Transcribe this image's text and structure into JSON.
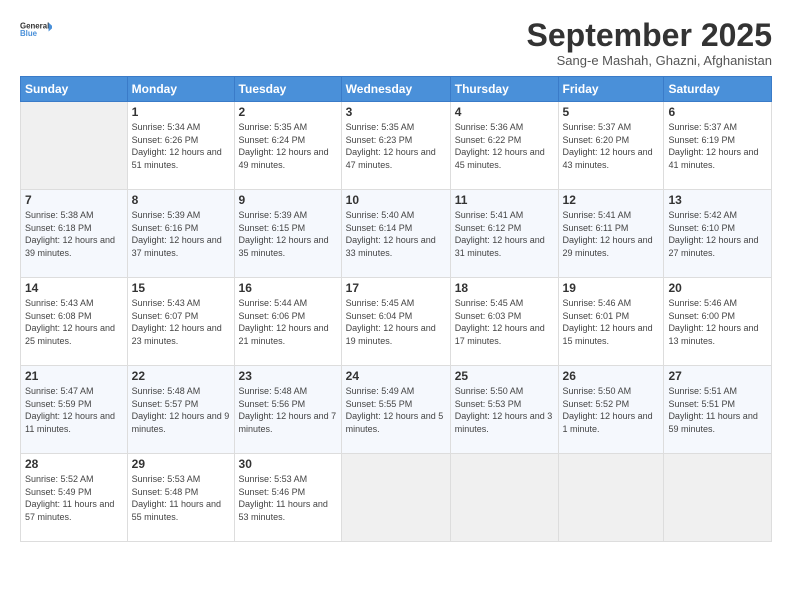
{
  "logo": {
    "general": "General",
    "blue": "Blue"
  },
  "header": {
    "title": "September 2025",
    "subtitle": "Sang-e Mashah, Ghazni, Afghanistan"
  },
  "days_of_week": [
    "Sunday",
    "Monday",
    "Tuesday",
    "Wednesday",
    "Thursday",
    "Friday",
    "Saturday"
  ],
  "weeks": [
    [
      {
        "day": "",
        "sunrise": "",
        "sunset": "",
        "daylight": "",
        "empty": true
      },
      {
        "day": "1",
        "sunrise": "Sunrise: 5:34 AM",
        "sunset": "Sunset: 6:26 PM",
        "daylight": "Daylight: 12 hours and 51 minutes."
      },
      {
        "day": "2",
        "sunrise": "Sunrise: 5:35 AM",
        "sunset": "Sunset: 6:24 PM",
        "daylight": "Daylight: 12 hours and 49 minutes."
      },
      {
        "day": "3",
        "sunrise": "Sunrise: 5:35 AM",
        "sunset": "Sunset: 6:23 PM",
        "daylight": "Daylight: 12 hours and 47 minutes."
      },
      {
        "day": "4",
        "sunrise": "Sunrise: 5:36 AM",
        "sunset": "Sunset: 6:22 PM",
        "daylight": "Daylight: 12 hours and 45 minutes."
      },
      {
        "day": "5",
        "sunrise": "Sunrise: 5:37 AM",
        "sunset": "Sunset: 6:20 PM",
        "daylight": "Daylight: 12 hours and 43 minutes."
      },
      {
        "day": "6",
        "sunrise": "Sunrise: 5:37 AM",
        "sunset": "Sunset: 6:19 PM",
        "daylight": "Daylight: 12 hours and 41 minutes."
      }
    ],
    [
      {
        "day": "7",
        "sunrise": "Sunrise: 5:38 AM",
        "sunset": "Sunset: 6:18 PM",
        "daylight": "Daylight: 12 hours and 39 minutes."
      },
      {
        "day": "8",
        "sunrise": "Sunrise: 5:39 AM",
        "sunset": "Sunset: 6:16 PM",
        "daylight": "Daylight: 12 hours and 37 minutes."
      },
      {
        "day": "9",
        "sunrise": "Sunrise: 5:39 AM",
        "sunset": "Sunset: 6:15 PM",
        "daylight": "Daylight: 12 hours and 35 minutes."
      },
      {
        "day": "10",
        "sunrise": "Sunrise: 5:40 AM",
        "sunset": "Sunset: 6:14 PM",
        "daylight": "Daylight: 12 hours and 33 minutes."
      },
      {
        "day": "11",
        "sunrise": "Sunrise: 5:41 AM",
        "sunset": "Sunset: 6:12 PM",
        "daylight": "Daylight: 12 hours and 31 minutes."
      },
      {
        "day": "12",
        "sunrise": "Sunrise: 5:41 AM",
        "sunset": "Sunset: 6:11 PM",
        "daylight": "Daylight: 12 hours and 29 minutes."
      },
      {
        "day": "13",
        "sunrise": "Sunrise: 5:42 AM",
        "sunset": "Sunset: 6:10 PM",
        "daylight": "Daylight: 12 hours and 27 minutes."
      }
    ],
    [
      {
        "day": "14",
        "sunrise": "Sunrise: 5:43 AM",
        "sunset": "Sunset: 6:08 PM",
        "daylight": "Daylight: 12 hours and 25 minutes."
      },
      {
        "day": "15",
        "sunrise": "Sunrise: 5:43 AM",
        "sunset": "Sunset: 6:07 PM",
        "daylight": "Daylight: 12 hours and 23 minutes."
      },
      {
        "day": "16",
        "sunrise": "Sunrise: 5:44 AM",
        "sunset": "Sunset: 6:06 PM",
        "daylight": "Daylight: 12 hours and 21 minutes."
      },
      {
        "day": "17",
        "sunrise": "Sunrise: 5:45 AM",
        "sunset": "Sunset: 6:04 PM",
        "daylight": "Daylight: 12 hours and 19 minutes."
      },
      {
        "day": "18",
        "sunrise": "Sunrise: 5:45 AM",
        "sunset": "Sunset: 6:03 PM",
        "daylight": "Daylight: 12 hours and 17 minutes."
      },
      {
        "day": "19",
        "sunrise": "Sunrise: 5:46 AM",
        "sunset": "Sunset: 6:01 PM",
        "daylight": "Daylight: 12 hours and 15 minutes."
      },
      {
        "day": "20",
        "sunrise": "Sunrise: 5:46 AM",
        "sunset": "Sunset: 6:00 PM",
        "daylight": "Daylight: 12 hours and 13 minutes."
      }
    ],
    [
      {
        "day": "21",
        "sunrise": "Sunrise: 5:47 AM",
        "sunset": "Sunset: 5:59 PM",
        "daylight": "Daylight: 12 hours and 11 minutes."
      },
      {
        "day": "22",
        "sunrise": "Sunrise: 5:48 AM",
        "sunset": "Sunset: 5:57 PM",
        "daylight": "Daylight: 12 hours and 9 minutes."
      },
      {
        "day": "23",
        "sunrise": "Sunrise: 5:48 AM",
        "sunset": "Sunset: 5:56 PM",
        "daylight": "Daylight: 12 hours and 7 minutes."
      },
      {
        "day": "24",
        "sunrise": "Sunrise: 5:49 AM",
        "sunset": "Sunset: 5:55 PM",
        "daylight": "Daylight: 12 hours and 5 minutes."
      },
      {
        "day": "25",
        "sunrise": "Sunrise: 5:50 AM",
        "sunset": "Sunset: 5:53 PM",
        "daylight": "Daylight: 12 hours and 3 minutes."
      },
      {
        "day": "26",
        "sunrise": "Sunrise: 5:50 AM",
        "sunset": "Sunset: 5:52 PM",
        "daylight": "Daylight: 12 hours and 1 minute."
      },
      {
        "day": "27",
        "sunrise": "Sunrise: 5:51 AM",
        "sunset": "Sunset: 5:51 PM",
        "daylight": "Daylight: 11 hours and 59 minutes."
      }
    ],
    [
      {
        "day": "28",
        "sunrise": "Sunrise: 5:52 AM",
        "sunset": "Sunset: 5:49 PM",
        "daylight": "Daylight: 11 hours and 57 minutes."
      },
      {
        "day": "29",
        "sunrise": "Sunrise: 5:53 AM",
        "sunset": "Sunset: 5:48 PM",
        "daylight": "Daylight: 11 hours and 55 minutes."
      },
      {
        "day": "30",
        "sunrise": "Sunrise: 5:53 AM",
        "sunset": "Sunset: 5:46 PM",
        "daylight": "Daylight: 11 hours and 53 minutes."
      },
      {
        "day": "",
        "sunrise": "",
        "sunset": "",
        "daylight": "",
        "empty": true
      },
      {
        "day": "",
        "sunrise": "",
        "sunset": "",
        "daylight": "",
        "empty": true
      },
      {
        "day": "",
        "sunrise": "",
        "sunset": "",
        "daylight": "",
        "empty": true
      },
      {
        "day": "",
        "sunrise": "",
        "sunset": "",
        "daylight": "",
        "empty": true
      }
    ]
  ]
}
